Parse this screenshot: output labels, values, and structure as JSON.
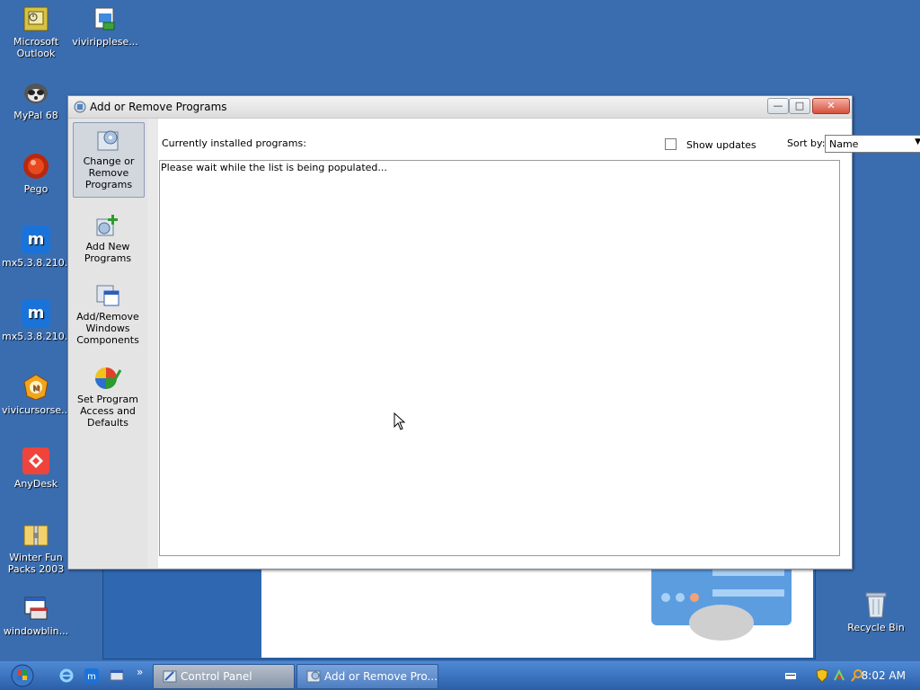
{
  "desktop_icons": [
    {
      "label": "Microsoft Outlook",
      "icon": "outlook-icon"
    },
    {
      "label": "viviripplese...",
      "icon": "installer-icon"
    },
    {
      "label": "MyPal 68",
      "icon": "mypal-icon"
    },
    {
      "label": "Pego",
      "icon": "pego-icon"
    },
    {
      "label": "mx5.3.8.210...",
      "icon": "maxthon-icon"
    },
    {
      "label": "mx5.3.8.210...",
      "icon": "maxthon-icon"
    },
    {
      "label": "vivicursorse...",
      "icon": "vivi-cursor-icon"
    },
    {
      "label": "AnyDesk",
      "icon": "anydesk-icon"
    },
    {
      "label": "Winter Fun Packs 2003",
      "icon": "zip-folder-icon"
    },
    {
      "label": "windowblin...",
      "icon": "windowblinds-icon"
    },
    {
      "label": "Recycle Bin",
      "icon": "recycle-bin-icon"
    }
  ],
  "window": {
    "title": "Add or Remove Programs",
    "nav": [
      {
        "label": "Change or Remove Programs",
        "selected": true
      },
      {
        "label": "Add New Programs",
        "selected": false
      },
      {
        "label": "Add/Remove Windows Components",
        "selected": false
      },
      {
        "label": "Set Program Access and Defaults",
        "selected": false
      }
    ],
    "currently_installed_label": "Currently installed programs:",
    "show_updates_label": "Show updates",
    "sort_by_label": "Sort by:",
    "sort_value": "Name",
    "list_message": "Please wait while the list is being populated..."
  },
  "taskbar": {
    "buttons": [
      {
        "label": "Control Panel",
        "active": true
      },
      {
        "label": "Add or Remove Pro...",
        "active": false
      }
    ],
    "quicklaunch_more": "»",
    "clock": "8:02 AM"
  },
  "colors": {
    "desktop": "#3a6db0",
    "taskbar": "#2b5fa8",
    "close_button": "#d6503b"
  }
}
